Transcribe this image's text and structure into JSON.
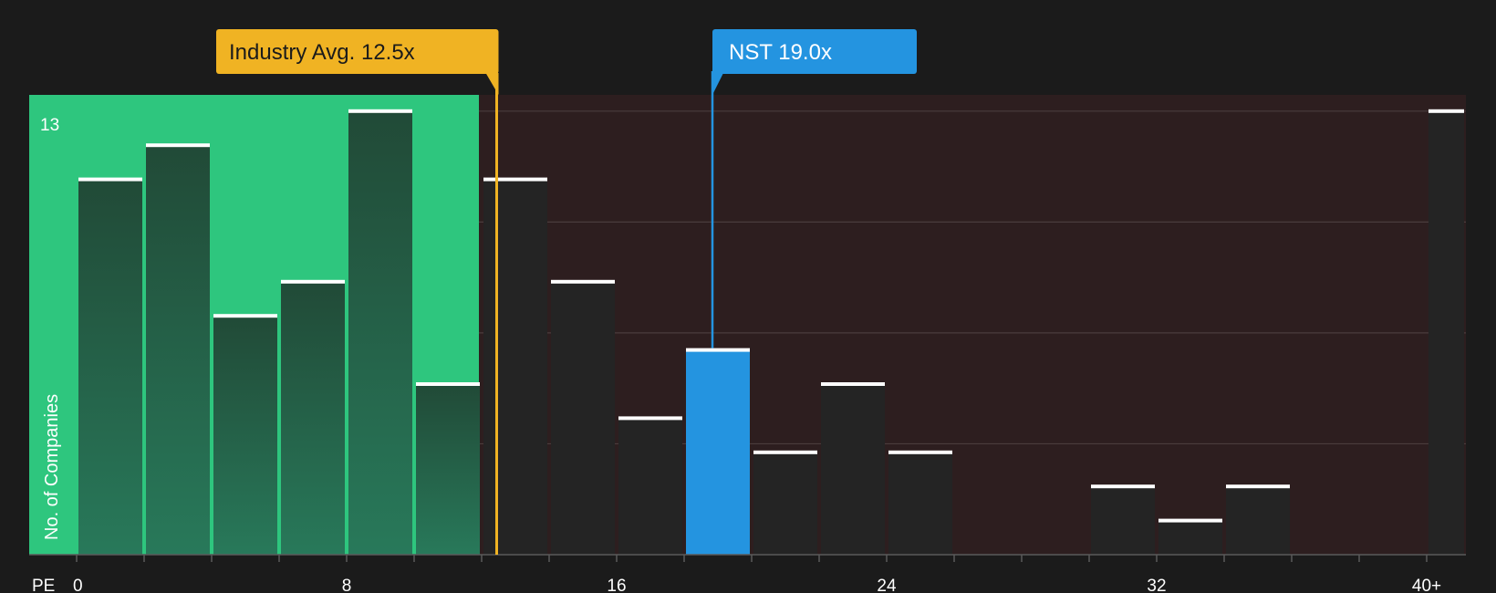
{
  "chart_data": {
    "type": "bar",
    "xlabel": "PE",
    "ylabel": "No. of Companies",
    "bin_width": 2,
    "x_range": [
      0,
      40
    ],
    "ylim": [
      0,
      13
    ],
    "y_tick_label": "13",
    "x_ticks": [
      {
        "value": 0,
        "label": "0"
      },
      {
        "value": 8,
        "label": "8"
      },
      {
        "value": 16,
        "label": "16"
      },
      {
        "value": 24,
        "label": "24"
      },
      {
        "value": 32,
        "label": "32"
      },
      {
        "value": 40,
        "label": "40+"
      }
    ],
    "bins": [
      {
        "start": 0,
        "count": 11
      },
      {
        "start": 2,
        "count": 12
      },
      {
        "start": 4,
        "count": 7
      },
      {
        "start": 6,
        "count": 8
      },
      {
        "start": 8,
        "count": 13
      },
      {
        "start": 10,
        "count": 5
      },
      {
        "start": 12,
        "count": 11
      },
      {
        "start": 14,
        "count": 8
      },
      {
        "start": 16,
        "count": 4
      },
      {
        "start": 18,
        "count": 6
      },
      {
        "start": 20,
        "count": 3
      },
      {
        "start": 22,
        "count": 5
      },
      {
        "start": 24,
        "count": 3
      },
      {
        "start": 30,
        "count": 2
      },
      {
        "start": 32,
        "count": 1
      },
      {
        "start": 34,
        "count": 2
      },
      {
        "start": 40,
        "count": 13
      }
    ],
    "industry_avg": {
      "value": 12.5,
      "label": "Industry Avg. 12.5x"
    },
    "company": {
      "name": "NST",
      "value": 19.0,
      "label": "NST 19.0x"
    },
    "colors": {
      "background": "#1b1b1b",
      "undervalued_region": "#2ec67e",
      "overvalued_region": "#2d1e1f",
      "industry_avg": "#f0b323",
      "company": "#2494e0",
      "bar_dark": "#242424",
      "bar_cap": "#ffffff"
    }
  }
}
